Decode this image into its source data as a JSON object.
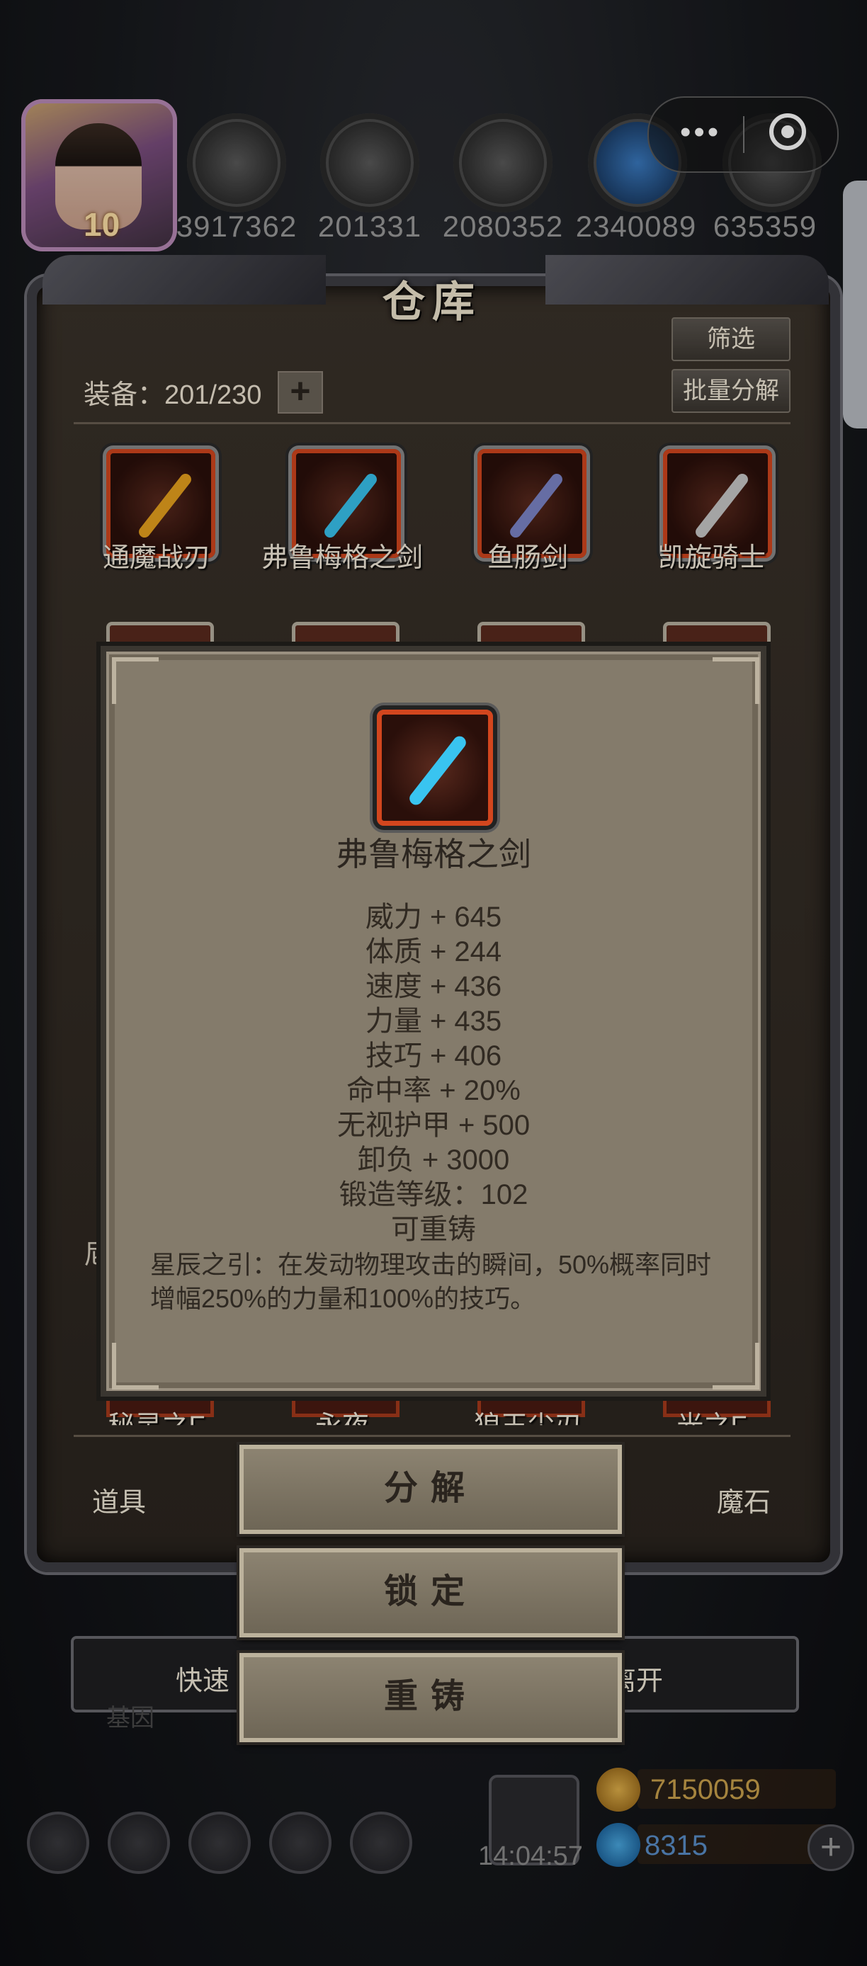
{
  "player": {
    "level": "10"
  },
  "resources": [
    {
      "icon": "meat-icon",
      "value": "3917362"
    },
    {
      "icon": "wood-icon",
      "value": "201331"
    },
    {
      "icon": "stone-icon",
      "value": "2080352"
    },
    {
      "icon": "crystal-icon",
      "value": "2340089"
    },
    {
      "icon": "iron-icon",
      "value": "635359"
    }
  ],
  "capsule": {
    "dots": "•••"
  },
  "warehouse": {
    "title": "仓库",
    "filter_label": "筛选",
    "batch_label": "批量分解",
    "equip_count": "装备：201/230",
    "plus": "+",
    "items": [
      {
        "name": "通魔战刃",
        "color": "#e8a21e"
      },
      {
        "name": "弗鲁梅格之剑",
        "color": "#39c4f0"
      },
      {
        "name": "鱼肠剑",
        "color": "#7d86c8"
      },
      {
        "name": "凯旋骑士",
        "color": "#c9c9c9"
      }
    ],
    "partial_left": "尼",
    "bottom_partial_names": [
      "秘灵之F",
      "永夜",
      "狼王尘刃",
      "光之F"
    ],
    "tabs": {
      "left": "道具",
      "right": "魔石"
    },
    "quick_left": "快速",
    "quick_right": "离开",
    "faded_label": "基因"
  },
  "popup": {
    "item_name": "弗鲁梅格之剑",
    "stats": [
      "威力 + 645",
      "体质 + 244",
      "速度 + 436",
      "力量 + 435",
      "技巧 + 406",
      "命中率 + 20%",
      "无视护甲 + 500",
      "卸负 + 3000",
      "锻造等级：102",
      "可重铸"
    ],
    "description": "星辰之引：在发动物理攻击的瞬间，50%概率同时增幅250%的力量和100%的技巧。"
  },
  "actions": {
    "decompose": "分解",
    "lock": "锁定",
    "reforge": "重铸"
  },
  "footer": {
    "time": "14:04:57",
    "gold": "7150059",
    "gems": "8315",
    "add": "+"
  }
}
